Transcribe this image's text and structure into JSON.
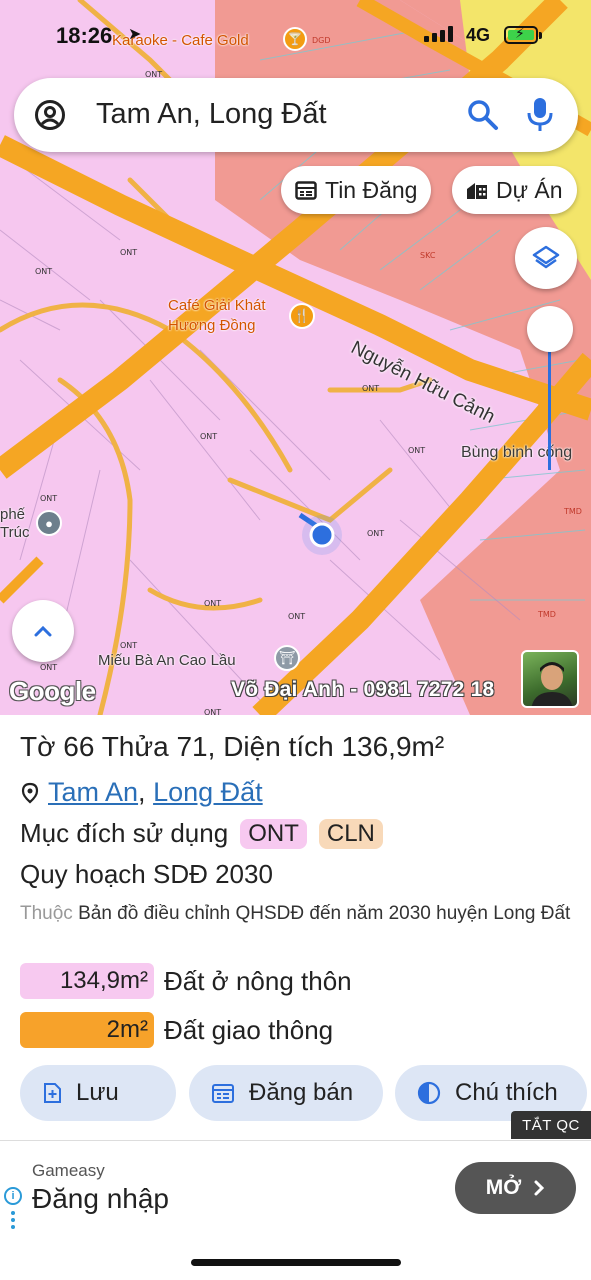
{
  "status_bar": {
    "time": "18:26",
    "network": "4G"
  },
  "map": {
    "search_query": "Tam An, Long Đất",
    "chips": {
      "listings": "Tin Đăng",
      "projects": "Dự Án"
    },
    "street": "Nguyễn Hữu Cảnh",
    "pois": {
      "karaoke": "Karaoke - Cafe Gold",
      "karaoke_suffix": "DGD",
      "cafe_line1": "Café Giải Khát",
      "cafe_line2": "Hương Đồng",
      "roundabout": "Bùng binh cống",
      "side_line1": "phế",
      "side_line2": "Trúc",
      "temple": "Miếu Bà An Cao Lầu"
    },
    "zone_codes": {
      "ont": "ONT",
      "skc": "SKC",
      "tmd": "TMD"
    },
    "google_logo": "Google",
    "watermark": "Võ Đại Anh - 0981 7272 18"
  },
  "panel": {
    "parcel": {
      "sheet_label": "Tờ",
      "sheet": "66",
      "lot_label": "Thửa",
      "lot": "71,",
      "area_label": "Diện tích",
      "area": "136,9m²"
    },
    "location": {
      "ward": "Tam An",
      "district": "Long Đất",
      "separator": ","
    },
    "purpose_label": "Mục đích sử dụng",
    "purpose_tags": [
      {
        "code": "ONT",
        "color": "#f7c9f0"
      },
      {
        "code": "CLN",
        "color": "#f8d9b9"
      }
    ],
    "plan_title": "Quy hoạch SDĐ 2030",
    "plan_source_prefix": "Thuộc",
    "plan_source": "Bản đồ điều chỉnh QHSDĐ đến năm 2030 huyện Long Đất",
    "areas": [
      {
        "value": "134,9m²",
        "label": "Đất ở nông thôn",
        "color": "#f7c9f0"
      },
      {
        "value": "2m²",
        "label": "Đất giao thông",
        "color": "#f7a22a"
      }
    ],
    "actions": {
      "save": "Lưu",
      "post_sale": "Đăng bán",
      "legend": "Chú thích"
    }
  },
  "ad": {
    "close_label": "TẮT QC",
    "brand": "Gameasy",
    "title": "Đăng nhập",
    "open_label": "MỞ"
  }
}
